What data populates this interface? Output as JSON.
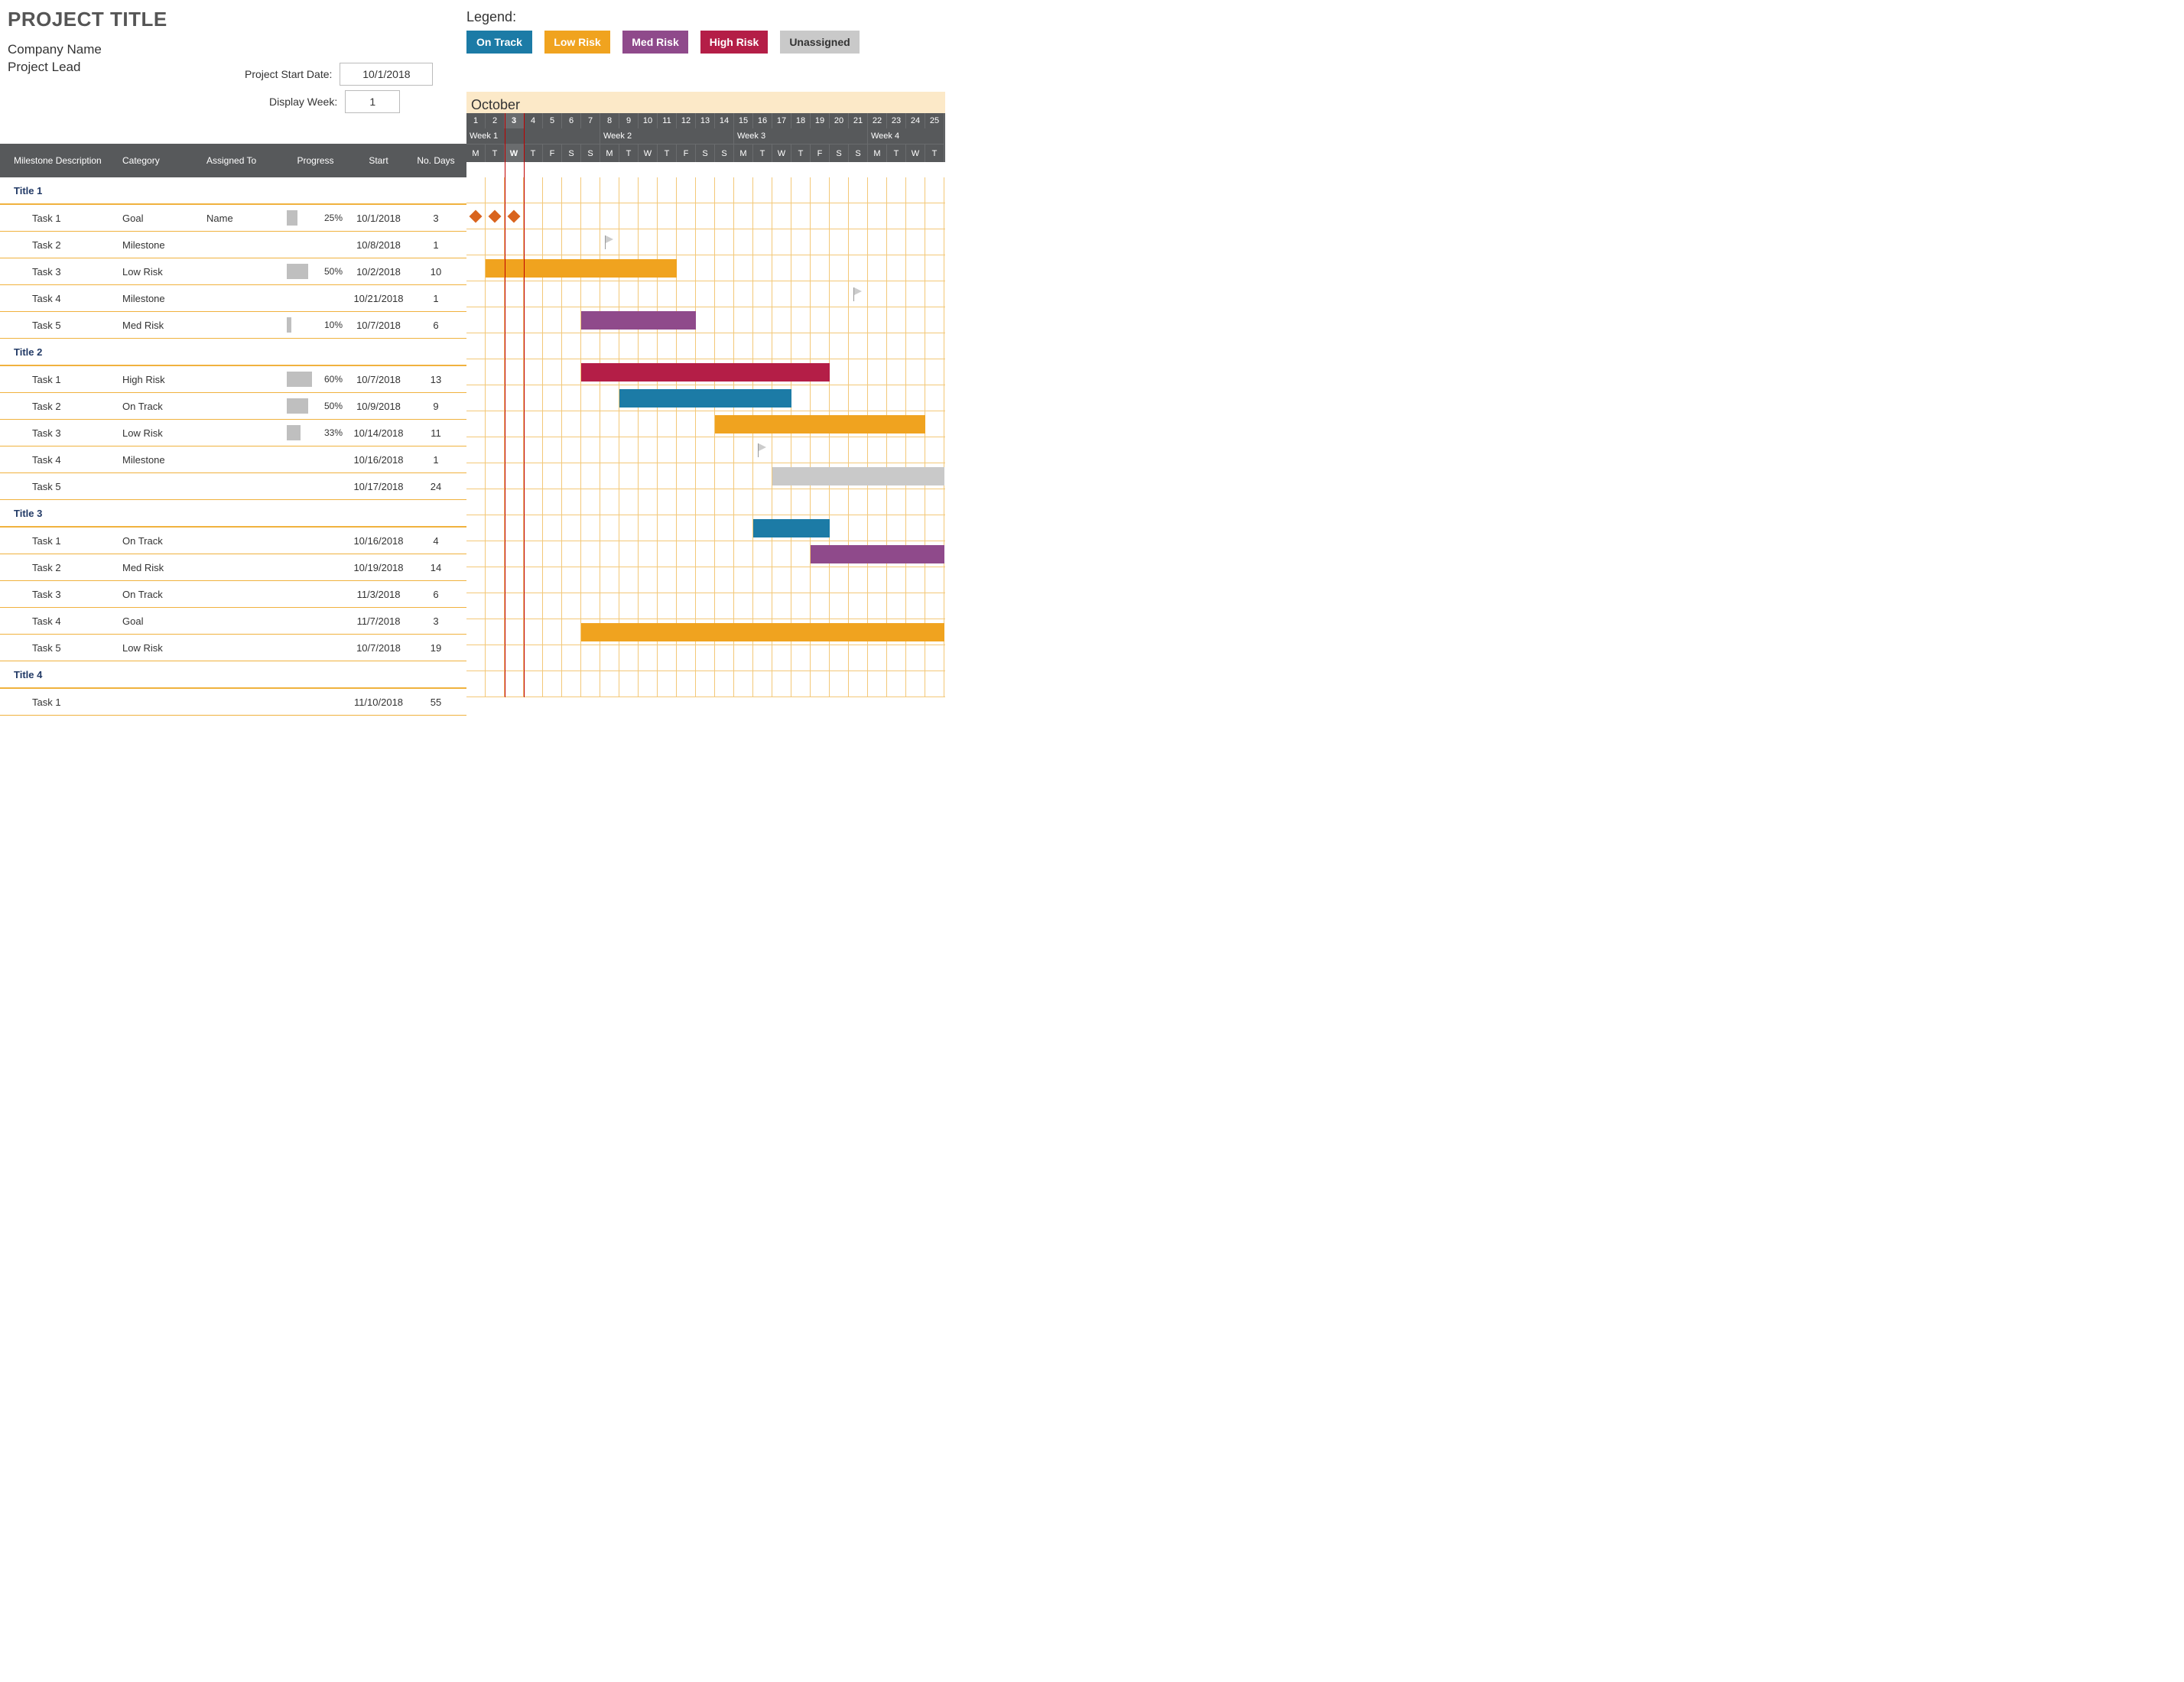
{
  "title": "PROJECT TITLE",
  "company": "Company Name",
  "lead": "Project Lead",
  "form": {
    "start_label": "Project Start Date:",
    "start_value": "10/1/2018",
    "week_label": "Display Week:",
    "week_value": "1"
  },
  "legend": {
    "label": "Legend:",
    "items": [
      {
        "name": "On Track",
        "cls": "c-ontrack",
        "w": 86
      },
      {
        "name": "Low Risk",
        "cls": "c-lowrisk",
        "w": 86
      },
      {
        "name": "Med Risk",
        "cls": "c-medrisk",
        "w": 86
      },
      {
        "name": "High Risk",
        "cls": "c-highrisk",
        "w": 88
      },
      {
        "name": "Unassigned",
        "cls": "c-unassigned",
        "w": 104
      }
    ]
  },
  "month": "October",
  "weeks": [
    {
      "label": "Week 1",
      "span": 7
    },
    {
      "label": "Week 2",
      "span": 7
    },
    {
      "label": "Week 3",
      "span": 7
    },
    {
      "label": "Week 4",
      "span": 4
    }
  ],
  "day_nums": [
    1,
    2,
    3,
    4,
    5,
    6,
    7,
    8,
    9,
    10,
    11,
    12,
    13,
    14,
    15,
    16,
    17,
    18,
    19,
    20,
    21,
    22,
    23,
    24,
    25
  ],
  "dows": [
    "M",
    "T",
    "W",
    "T",
    "F",
    "S",
    "S",
    "M",
    "T",
    "W",
    "T",
    "F",
    "S",
    "S",
    "M",
    "T",
    "W",
    "T",
    "F",
    "S",
    "S",
    "M",
    "T",
    "W",
    "T"
  ],
  "today_col": 3,
  "left_headers": {
    "desc": "Milestone Description",
    "cat": "Category",
    "asg": "Assigned To",
    "prog": "Progress",
    "start": "Start",
    "days": "No. Days"
  },
  "rows": [
    {
      "type": "section",
      "desc": "Title 1"
    },
    {
      "type": "task",
      "desc": "Task 1",
      "cat": "Goal",
      "asg": "Name",
      "prog": 25,
      "start": "10/1/2018",
      "days": 3,
      "bar": {
        "kind": "goal",
        "from": 1,
        "len": 3
      }
    },
    {
      "type": "task",
      "desc": "Task 2",
      "cat": "Milestone",
      "asg": "",
      "prog": null,
      "start": "10/8/2018",
      "days": 1,
      "bar": {
        "kind": "flag",
        "from": 8
      }
    },
    {
      "type": "task",
      "desc": "Task 3",
      "cat": "Low Risk",
      "asg": "",
      "prog": 50,
      "start": "10/2/2018",
      "days": 10,
      "bar": {
        "kind": "bar",
        "cls": "c-lowrisk",
        "from": 2,
        "len": 10
      }
    },
    {
      "type": "task",
      "desc": "Task 4",
      "cat": "Milestone",
      "asg": "",
      "prog": null,
      "start": "10/21/2018",
      "days": 1,
      "bar": {
        "kind": "flag",
        "from": 21
      }
    },
    {
      "type": "task",
      "desc": "Task 5",
      "cat": "Med Risk",
      "asg": "",
      "prog": 10,
      "start": "10/7/2018",
      "days": 6,
      "bar": {
        "kind": "bar",
        "cls": "c-medrisk",
        "from": 7,
        "len": 6
      }
    },
    {
      "type": "section",
      "desc": "Title 2"
    },
    {
      "type": "task",
      "desc": "Task 1",
      "cat": "High Risk",
      "asg": "",
      "prog": 60,
      "start": "10/7/2018",
      "days": 13,
      "bar": {
        "kind": "bar",
        "cls": "c-highrisk",
        "from": 7,
        "len": 13
      }
    },
    {
      "type": "task",
      "desc": "Task 2",
      "cat": "On Track",
      "asg": "",
      "prog": 50,
      "start": "10/9/2018",
      "days": 9,
      "bar": {
        "kind": "bar",
        "cls": "c-ontrack",
        "from": 9,
        "len": 9
      }
    },
    {
      "type": "task",
      "desc": "Task 3",
      "cat": "Low Risk",
      "asg": "",
      "prog": 33,
      "start": "10/14/2018",
      "days": 11,
      "bar": {
        "kind": "bar",
        "cls": "c-lowrisk",
        "from": 14,
        "len": 11
      }
    },
    {
      "type": "task",
      "desc": "Task 4",
      "cat": "Milestone",
      "asg": "",
      "prog": null,
      "start": "10/16/2018",
      "days": 1,
      "bar": {
        "kind": "flag",
        "from": 16
      }
    },
    {
      "type": "task",
      "desc": "Task 5",
      "cat": "",
      "asg": "",
      "prog": null,
      "start": "10/17/2018",
      "days": 24,
      "bar": {
        "kind": "bar",
        "cls": "c-unassigned",
        "from": 17,
        "len": 24
      }
    },
    {
      "type": "section",
      "desc": "Title 3"
    },
    {
      "type": "task",
      "desc": "Task 1",
      "cat": "On Track",
      "asg": "",
      "prog": null,
      "start": "10/16/2018",
      "days": 4,
      "bar": {
        "kind": "bar",
        "cls": "c-ontrack",
        "from": 16,
        "len": 4
      }
    },
    {
      "type": "task",
      "desc": "Task 2",
      "cat": "Med Risk",
      "asg": "",
      "prog": null,
      "start": "10/19/2018",
      "days": 14,
      "bar": {
        "kind": "bar",
        "cls": "c-medrisk",
        "from": 19,
        "len": 14
      }
    },
    {
      "type": "task",
      "desc": "Task 3",
      "cat": "On Track",
      "asg": "",
      "prog": null,
      "start": "11/3/2018",
      "days": 6,
      "bar": null
    },
    {
      "type": "task",
      "desc": "Task 4",
      "cat": "Goal",
      "asg": "",
      "prog": null,
      "start": "11/7/2018",
      "days": 3,
      "bar": null
    },
    {
      "type": "task",
      "desc": "Task 5",
      "cat": "Low Risk",
      "asg": "",
      "prog": null,
      "start": "10/7/2018",
      "days": 19,
      "bar": {
        "kind": "bar",
        "cls": "c-lowrisk",
        "from": 7,
        "len": 19
      }
    },
    {
      "type": "section",
      "desc": "Title 4"
    },
    {
      "type": "task",
      "desc": "Task 1",
      "cat": "",
      "asg": "",
      "prog": null,
      "start": "11/10/2018",
      "days": 55,
      "bar": null
    }
  ],
  "chart_data": {
    "type": "gantt",
    "start_date": "2018-10-01",
    "visible_days": 25,
    "today": "2018-10-03",
    "categories": {
      "On Track": "#1c7ba6",
      "Low Risk": "#f0a31f",
      "Med Risk": "#8f4a8b",
      "High Risk": "#b41e47",
      "Unassigned": "#c9c9c9",
      "Goal": "diamond",
      "Milestone": "flag"
    },
    "groups": [
      {
        "title": "Title 1",
        "tasks": [
          {
            "name": "Task 1",
            "category": "Goal",
            "assigned": "Name",
            "progress": 25,
            "start": "2018-10-01",
            "days": 3
          },
          {
            "name": "Task 2",
            "category": "Milestone",
            "start": "2018-10-08",
            "days": 1
          },
          {
            "name": "Task 3",
            "category": "Low Risk",
            "progress": 50,
            "start": "2018-10-02",
            "days": 10
          },
          {
            "name": "Task 4",
            "category": "Milestone",
            "start": "2018-10-21",
            "days": 1
          },
          {
            "name": "Task 5",
            "category": "Med Risk",
            "progress": 10,
            "start": "2018-10-07",
            "days": 6
          }
        ]
      },
      {
        "title": "Title 2",
        "tasks": [
          {
            "name": "Task 1",
            "category": "High Risk",
            "progress": 60,
            "start": "2018-10-07",
            "days": 13
          },
          {
            "name": "Task 2",
            "category": "On Track",
            "progress": 50,
            "start": "2018-10-09",
            "days": 9
          },
          {
            "name": "Task 3",
            "category": "Low Risk",
            "progress": 33,
            "start": "2018-10-14",
            "days": 11
          },
          {
            "name": "Task 4",
            "category": "Milestone",
            "start": "2018-10-16",
            "days": 1
          },
          {
            "name": "Task 5",
            "category": "Unassigned",
            "start": "2018-10-17",
            "days": 24
          }
        ]
      },
      {
        "title": "Title 3",
        "tasks": [
          {
            "name": "Task 1",
            "category": "On Track",
            "start": "2018-10-16",
            "days": 4
          },
          {
            "name": "Task 2",
            "category": "Med Risk",
            "start": "2018-10-19",
            "days": 14
          },
          {
            "name": "Task 3",
            "category": "On Track",
            "start": "2018-11-03",
            "days": 6
          },
          {
            "name": "Task 4",
            "category": "Goal",
            "start": "2018-11-07",
            "days": 3
          },
          {
            "name": "Task 5",
            "category": "Low Risk",
            "start": "2018-10-07",
            "days": 19
          }
        ]
      },
      {
        "title": "Title 4",
        "tasks": [
          {
            "name": "Task 1",
            "category": "",
            "start": "2018-11-10",
            "days": 55
          }
        ]
      }
    ]
  }
}
